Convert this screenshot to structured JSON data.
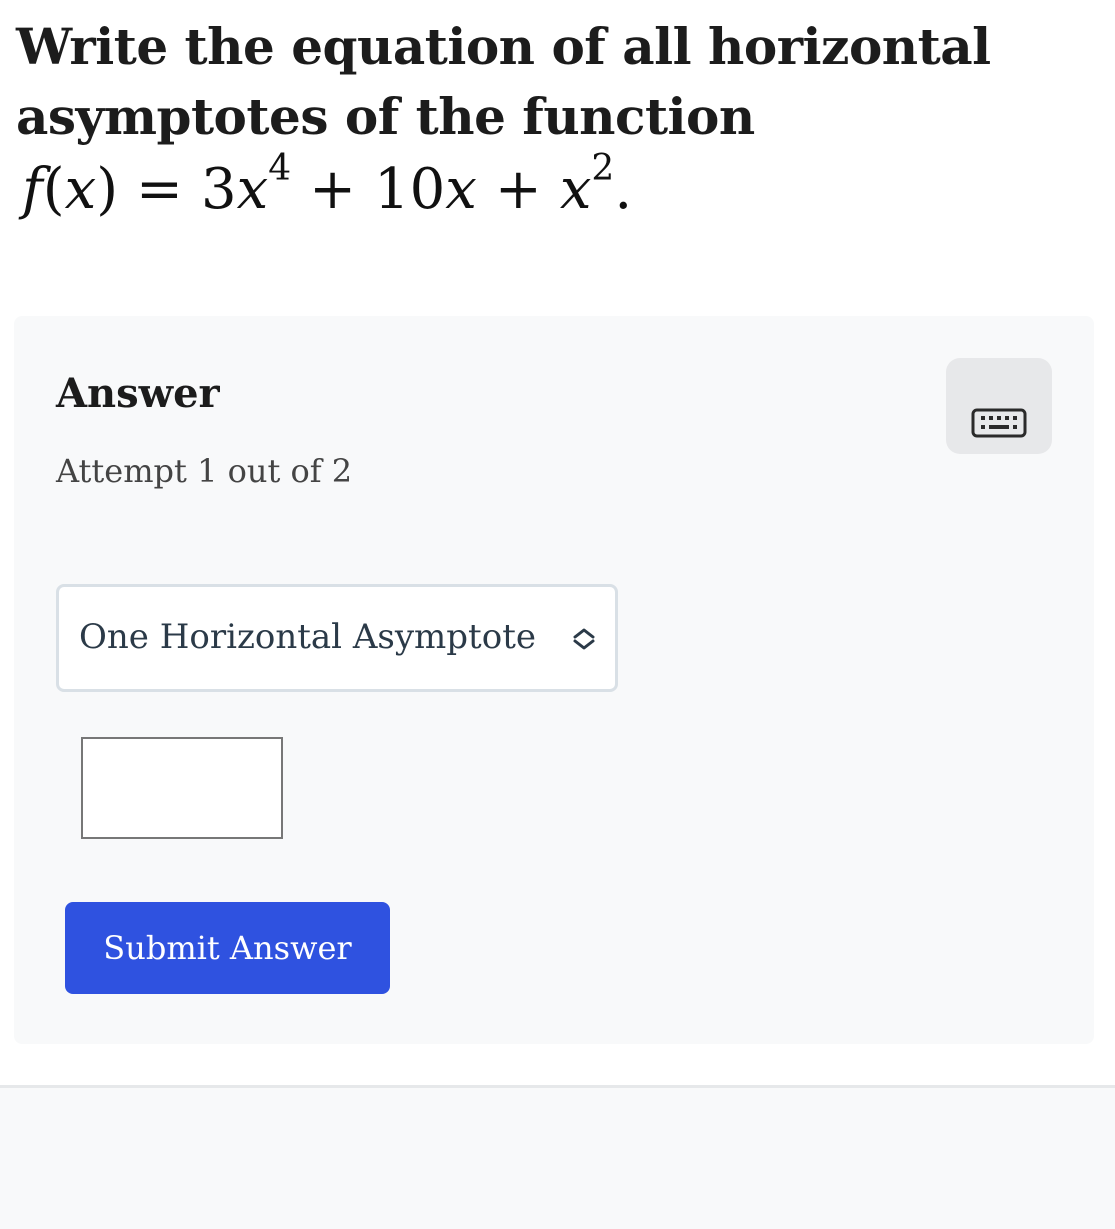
{
  "question": {
    "line1": "Write the equation of all horizontal",
    "line2": "asymptotes of the function",
    "formula": {
      "f": "f",
      "open": "(",
      "x": "x",
      "close": ")",
      "eq": "=",
      "coef1": "3",
      "x1": "x",
      "exp1": "4",
      "plus1": "+",
      "coef2": "10",
      "x2": "x",
      "plus2": "+",
      "x3": "x",
      "exp2": "2",
      "period": "."
    }
  },
  "answer": {
    "title": "Answer",
    "keyboard_icon": "keyboard-icon",
    "attempt": "Attempt 1 out of 2",
    "select": {
      "selected": "One Horizontal Asymptote",
      "chevron_icon": "chevron-up-down-icon"
    },
    "input_value": "",
    "submit_label": "Submit Answer"
  },
  "colors": {
    "accent": "#2f52e0",
    "panel_bg": "#f8f9fa",
    "border": "#d9e0e6"
  }
}
